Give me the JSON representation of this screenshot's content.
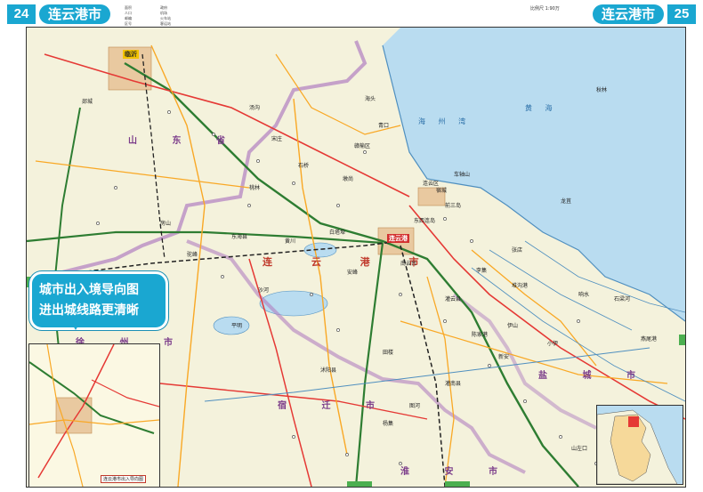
{
  "header": {
    "left_page": "24",
    "left_title": "连云港市",
    "right_page": "25",
    "right_title": "连云港市",
    "right_scale": "比例尺 1:90万"
  },
  "legend_strip": {
    "items": [
      "面积",
      "人口",
      "邮编",
      "区号",
      "政府",
      "机场",
      "火车站",
      "客运站"
    ]
  },
  "region_labels": {
    "shandong": "山 东 省",
    "lianyungang": "连 云 港 市",
    "suqian": "宿 迁 市",
    "yancheng": "盐 城 市",
    "huaian": "淮 安 市",
    "xuzhou": "徐 州 市",
    "sea": "黄 海",
    "haizhou_bay": "海 州 湾"
  },
  "cities": {
    "lianyungang": "连云港",
    "linyi": "临沂",
    "lianyun": "连云区"
  },
  "places": [
    "郯城",
    "东海县",
    "赣榆区",
    "灌云县",
    "灌南县",
    "沭阳县",
    "新沂",
    "海头",
    "青口",
    "墩尚",
    "石桥",
    "宋庄",
    "沙河",
    "黄川",
    "白塔埠",
    "驼峰",
    "安峰",
    "平明",
    "房山",
    "桃林",
    "山左口",
    "石梁河",
    "响水",
    "燕尾港",
    "堆沟港",
    "陈家港",
    "田楼",
    "新安",
    "李集",
    "张店",
    "伊山",
    "小伊",
    "图河",
    "杨集",
    "汤沟",
    "龙苴",
    "秋林",
    "车轴山",
    "前三岛",
    "东西连岛",
    "南云台",
    "宿城",
    "板浦",
    "墟沟"
  ],
  "callout": {
    "line1": "城市出入境导向图",
    "line2": "进出城线路更清晰"
  },
  "inset": {
    "caption": "连云港市出入导向图"
  },
  "colors": {
    "accent": "#1aa7d1",
    "sea": "#b9dcf0",
    "land": "#f4f2dc",
    "border": "#b07fc0",
    "highway": "#2e7d32",
    "national_road": "#e53935",
    "provincial_road": "#f9a825",
    "railway": "#222222"
  }
}
